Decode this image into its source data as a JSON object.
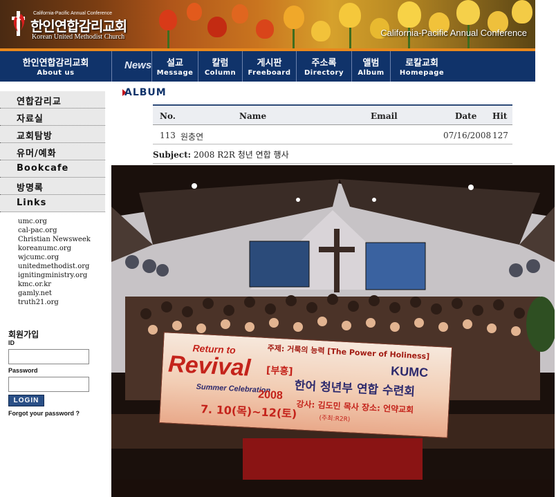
{
  "header": {
    "logo_small": "California-Pacific Annual Conference",
    "logo_korean": "한인연합감리교회",
    "logo_english": "Korean United Methodist Church",
    "conference": "California-Pacific Annual Conference"
  },
  "nav": {
    "news_label": "News",
    "items": [
      {
        "ko": "한인연합감리교회",
        "en": "About us"
      },
      {
        "ko": "설교",
        "en": "Message"
      },
      {
        "ko": "칼럼",
        "en": "Column"
      },
      {
        "ko": "게시판",
        "en": "Freeboard"
      },
      {
        "ko": "주소록",
        "en": "Directory"
      },
      {
        "ko": "앨범",
        "en": "Album"
      },
      {
        "ko": "로칼교회",
        "en": "Homepage"
      }
    ]
  },
  "sidebar": {
    "menu": [
      "연합감리교",
      "자료실",
      "교회탐방",
      "유머/예화",
      "Bookcafe",
      "방명록",
      "Links"
    ],
    "links": [
      "umc.org",
      "cal-pac.org",
      "Christian Newsweek",
      "koreanumc.org",
      "wjcumc.org",
      "unitedmethodist.org",
      "ignitingministry.org",
      "kmc.or.kr",
      "gamly.net",
      "truth21.org"
    ],
    "join_title": "회원가입",
    "id_label": "ID",
    "password_label": "Password",
    "login_label": "LOGIN",
    "forgot_label": "Forgot your password ?"
  },
  "album": {
    "title": "ALBUM",
    "columns": {
      "no": "No.",
      "name": "Name",
      "email": "Email",
      "date": "Date",
      "hit": "Hit"
    },
    "row": {
      "no": "113",
      "name": "원충연",
      "email": "",
      "date": "07/16/2008",
      "hit": "127"
    },
    "subject_label": "Subject:",
    "subject": "2008 R2R 청년 연합 행사"
  },
  "photo": {
    "banner_top": "주제: 거룩의 능력 [The Power of Holiness]",
    "banner_return": "Return to",
    "banner_revival": "Revival",
    "banner_tag": "[부흥]",
    "banner_summer": "Summer Celebration",
    "banner_year": "2008",
    "banner_dates": "7. 10(목)~12(토)",
    "banner_kumc": "KUMC",
    "banner_title": "한어 청년부 연합 수련회",
    "banner_details": "강사: 김도민 목사   장소: 언약교회",
    "banner_host": "(주최:R2R)"
  },
  "colors": {
    "nav_bg": "#10336a",
    "accent_orange": "#e8881d",
    "banner_red": "#c4231b"
  }
}
